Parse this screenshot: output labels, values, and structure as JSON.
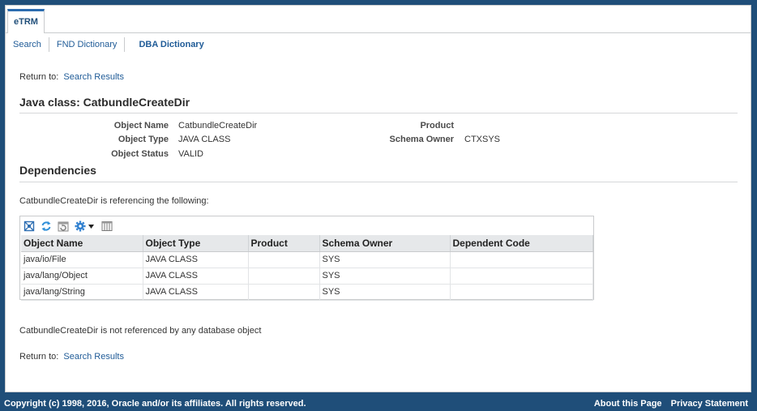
{
  "tabs": [
    {
      "label": "eTRM"
    }
  ],
  "subnav": {
    "items": [
      "Search",
      "FND Dictionary",
      "DBA Dictionary"
    ]
  },
  "return_to": {
    "label": "Return to:",
    "link": "Search Results"
  },
  "title": "Java class: CatbundleCreateDir",
  "properties": {
    "object_name": {
      "label": "Object Name",
      "value": "CatbundleCreateDir"
    },
    "object_type": {
      "label": "Object Type",
      "value": "JAVA CLASS"
    },
    "object_status": {
      "label": "Object Status",
      "value": "VALID"
    },
    "product": {
      "label": "Product",
      "value": ""
    },
    "schema_owner": {
      "label": "Schema Owner",
      "value": "CTXSYS"
    }
  },
  "dependencies": {
    "heading": "Dependencies",
    "referencing_text": "CatbundleCreateDir is referencing the following:",
    "not_referenced_text": "CatbundleCreateDir is not referenced by any database object",
    "toolbar_icons": [
      "detach-icon",
      "refresh-icon",
      "reset-icon",
      "gear-icon",
      "dropdown-arrow-icon",
      "columns-icon"
    ],
    "columns": [
      "Object Name",
      "Object Type",
      "Product",
      "Schema Owner",
      "Dependent Code"
    ],
    "rows": [
      [
        "java/io/File",
        "JAVA CLASS",
        "",
        "SYS",
        ""
      ],
      [
        "java/lang/Object",
        "JAVA CLASS",
        "",
        "SYS",
        ""
      ],
      [
        "java/lang/String",
        "JAVA CLASS",
        "",
        "SYS",
        ""
      ]
    ]
  },
  "footer": {
    "copyright": "Copyright (c) 1998, 2016, Oracle and/or its affiliates. All rights reserved.",
    "links": [
      "About this Page",
      "Privacy Statement"
    ]
  },
  "colors": {
    "brand": "#1f4e79",
    "link": "#1f5b97",
    "header_bg": "#e6e8ea"
  }
}
